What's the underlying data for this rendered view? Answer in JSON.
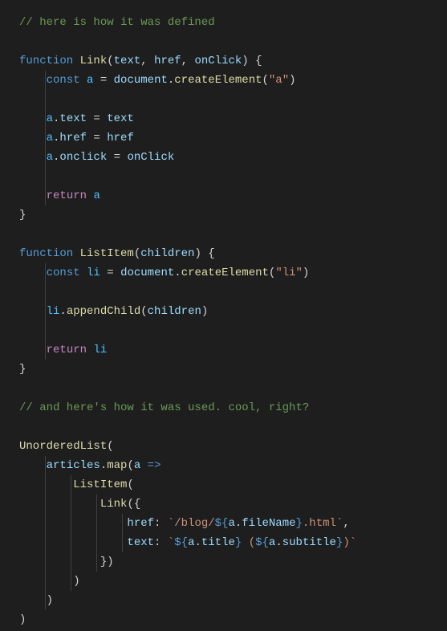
{
  "code": {
    "c1": "// here is how it was defined",
    "l1_function": "function",
    "l1_fn": "Link",
    "l1_p1": "text",
    "l1_p2": "href",
    "l1_p3": "onClick",
    "l2_const": "const",
    "l2_var": "a",
    "l2_eq": " = ",
    "l2_doc": "document",
    "l2_method": "createElement",
    "l2_arg": "\"a\"",
    "l3_a": "a",
    "l3_prop1": "text",
    "l3_val1": "text",
    "l4_a": "a",
    "l4_prop": "href",
    "l4_val": "href",
    "l5_a": "a",
    "l5_prop": "onclick",
    "l5_val": "onClick",
    "l6_return": "return",
    "l6_a": "a",
    "fn2_name": "ListItem",
    "fn2_param": "children",
    "fn2_var": "li",
    "fn2_doc": "document",
    "fn2_method": "createElement",
    "fn2_arg": "\"li\"",
    "fn2_li": "li",
    "fn2_append": "appendChild",
    "fn2_child": "children",
    "fn2_return": "return",
    "fn2_ret_li": "li",
    "c2": "// and here's how it was used. cool, right?",
    "ul": "UnorderedList",
    "articles": "articles",
    "map": "map",
    "arrow_a": "a",
    "li_fn": "ListItem",
    "link_fn": "Link",
    "href_key": "href",
    "href_s1": "`/blog/",
    "href_interp1_a": "a",
    "href_interp1_prop": "fileName",
    "href_s2": ".html`",
    "text_key": "text",
    "text_s1": "`",
    "text_interp1_a": "a",
    "text_interp1_prop": "title",
    "text_s_mid": " (",
    "text_interp2_a": "a",
    "text_interp2_prop": "subtitle",
    "text_s_end": ")`"
  }
}
